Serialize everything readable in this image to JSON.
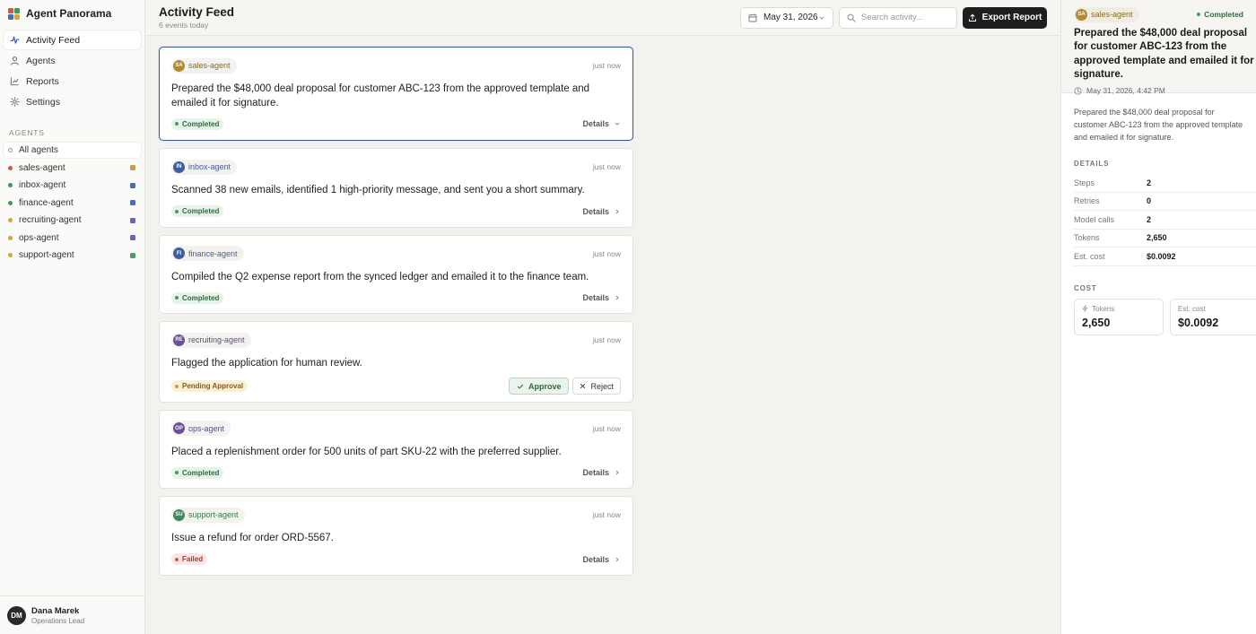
{
  "brand": {
    "name": "Agent Panorama",
    "logo_colors": [
      "#d9534a",
      "#3a9b5c",
      "#3b6fb6",
      "#e0a22b"
    ]
  },
  "nav": [
    {
      "label": "Activity Feed",
      "icon": "activity-icon",
      "active": true
    },
    {
      "label": "Agents",
      "icon": "user-icon",
      "active": false
    },
    {
      "label": "Reports",
      "icon": "chart-icon",
      "active": false
    },
    {
      "label": "Settings",
      "icon": "gear-icon",
      "active": false
    }
  ],
  "agents_section": "AGENTS",
  "agents": [
    {
      "label": "All agents",
      "color": "",
      "swatch": "",
      "active": true
    },
    {
      "label": "sales-agent",
      "color": "#d9534a",
      "swatch": "#c79a4f"
    },
    {
      "label": "inbox-agent",
      "color": "#3a9b5c",
      "swatch": "#4a6fb0"
    },
    {
      "label": "finance-agent",
      "color": "#3a9b5c",
      "swatch": "#4a6fb0"
    },
    {
      "label": "recruiting-agent",
      "color": "#e0a22b",
      "swatch": "#7a5fb0"
    },
    {
      "label": "ops-agent",
      "color": "#e0a22b",
      "swatch": "#7a5fb0"
    },
    {
      "label": "support-agent",
      "color": "#e0a22b",
      "swatch": "#4f9a6a"
    }
  ],
  "user": {
    "initials": "DM",
    "name": "Dana Marek",
    "role": "Operations Lead"
  },
  "header": {
    "title": "Activity Feed",
    "subtitle": "6 events today",
    "date": "May 31, 2026",
    "search_placeholder": "Search activity...",
    "export_label": "Export Report"
  },
  "feed": [
    {
      "agent": "sales-agent",
      "initials": "SA",
      "badge_color": "#b08a2e",
      "pill_text_color": "#8a6a1e",
      "time": "just now",
      "text": "Prepared the $48,000 deal proposal for customer ABC-123 from the approved template and emailed it for signature.",
      "status": "Completed",
      "status_kind": "completed",
      "details": "Details",
      "expanded": true
    },
    {
      "agent": "inbox-agent",
      "initials": "IN",
      "badge_color": "#3d5f9a",
      "pill_text_color": "#3d5f9a",
      "time": "just now",
      "text": "Scanned 38 new emails, identified 1 high-priority message, and sent you a short summary.",
      "status": "Completed",
      "status_kind": "completed",
      "details": "Details"
    },
    {
      "agent": "finance-agent",
      "initials": "FI",
      "badge_color": "#3d5f9a",
      "pill_text_color": "#3d5f9a",
      "time": "just now",
      "text": "Compiled the Q2 expense report from the synced ledger and emailed it to the finance team.",
      "status": "Completed",
      "status_kind": "completed",
      "details": "Details"
    },
    {
      "agent": "recruiting-agent",
      "initials": "RE",
      "badge_color": "#6a4f9a",
      "pill_text_color": "#5f4a8a",
      "time": "just now",
      "text": "Flagged the application for human review.",
      "status": "Pending Approval",
      "status_kind": "pending",
      "approve": "Approve",
      "reject": "Reject"
    },
    {
      "agent": "ops-agent",
      "initials": "OP",
      "badge_color": "#6a4f9a",
      "pill_text_color": "#5f4a8a",
      "time": "just now",
      "text": "Placed a replenishment order for 500 units of part SKU-22 with the preferred supplier.",
      "status": "Completed",
      "status_kind": "completed",
      "details": "Details"
    },
    {
      "agent": "support-agent",
      "initials": "SU",
      "badge_color": "#3d8a5a",
      "pill_text_color": "#2f7a4a",
      "time": "just now",
      "text": "Issue a refund for order ORD-5567.",
      "status": "Failed",
      "status_kind": "failed",
      "details": "Details"
    }
  ],
  "panel": {
    "agent": "sales-agent",
    "initials": "SA",
    "status": "Completed",
    "title": "Prepared the $48,000 deal proposal for customer ABC-123 from the approved template and emailed it for signature.",
    "timestamp": "May 31, 2026, 4:42 PM",
    "description": "Prepared the $48,000 deal proposal for customer ABC-123 from the approved template and emailed it for signature.",
    "details_label": "DETAILS",
    "details": [
      {
        "k": "Steps",
        "v": "2"
      },
      {
        "k": "Retries",
        "v": "0"
      },
      {
        "k": "Model calls",
        "v": "2"
      },
      {
        "k": "Tokens",
        "v": "2,650"
      },
      {
        "k": "Est. cost",
        "v": "$0.0092"
      }
    ],
    "cost_label": "COST",
    "cost": [
      {
        "label": "Tokens",
        "value": "2,650",
        "icon": "bolt-icon"
      },
      {
        "label": "Est. cost",
        "value": "$0.0092"
      }
    ]
  }
}
